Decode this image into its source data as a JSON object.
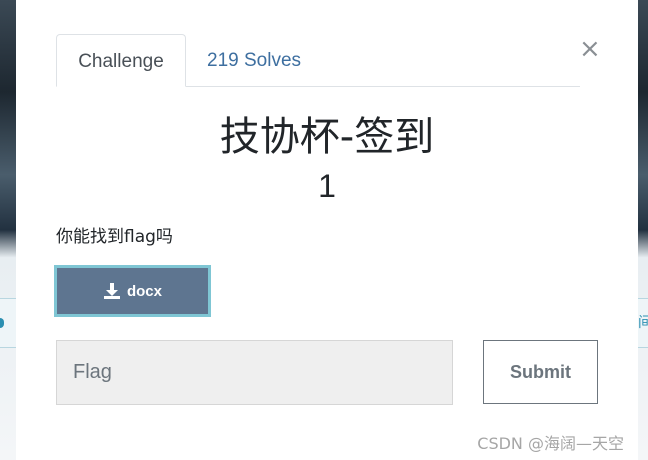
{
  "modal": {
    "tabs": [
      {
        "label": "Challenge",
        "active": true
      },
      {
        "label": "219 Solves",
        "active": false
      }
    ],
    "close_glyph": "×",
    "title": "技协杯-签到",
    "value": "1",
    "description": "你能找到flag吗",
    "file_button": {
      "label": "docx",
      "icon": "download-icon"
    },
    "flag_input": {
      "value": "",
      "placeholder": "Flag"
    },
    "submit_label": "Submit"
  },
  "background": {
    "right_glyph": "间"
  },
  "watermark": "CSDN @海阔—天空",
  "colors": {
    "link": "#3e6fa0",
    "file_button_bg": "#5e7590",
    "file_button_border": "#7fc6d4"
  }
}
